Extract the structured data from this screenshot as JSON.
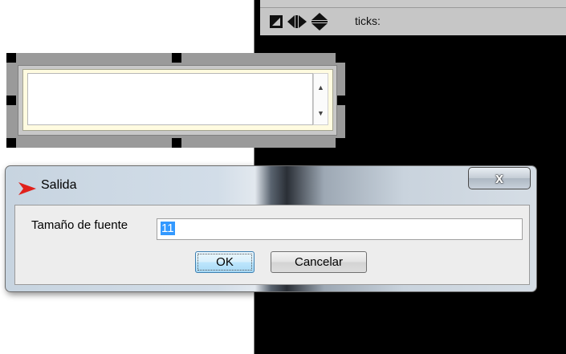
{
  "right_panel": {
    "toolbar": {
      "icons": [
        "square-diagonal-icon",
        "left-right-arrows-icon",
        "up-down-arrows-icon"
      ],
      "ticks_label": "ticks:"
    },
    "background_color": "#000000"
  },
  "widget": {
    "textarea_value": "",
    "scroll_up_glyph": "▲",
    "scroll_down_glyph": "▼"
  },
  "dialog": {
    "title": "Salida",
    "logo_icon": "red-arrow-icon",
    "close_glyph": "x",
    "font_size_label": "Tamaño de fuente",
    "font_size_value": "11",
    "ok_label": "OK",
    "cancel_label": "Cancelar",
    "accent_color": "#e0211b"
  }
}
